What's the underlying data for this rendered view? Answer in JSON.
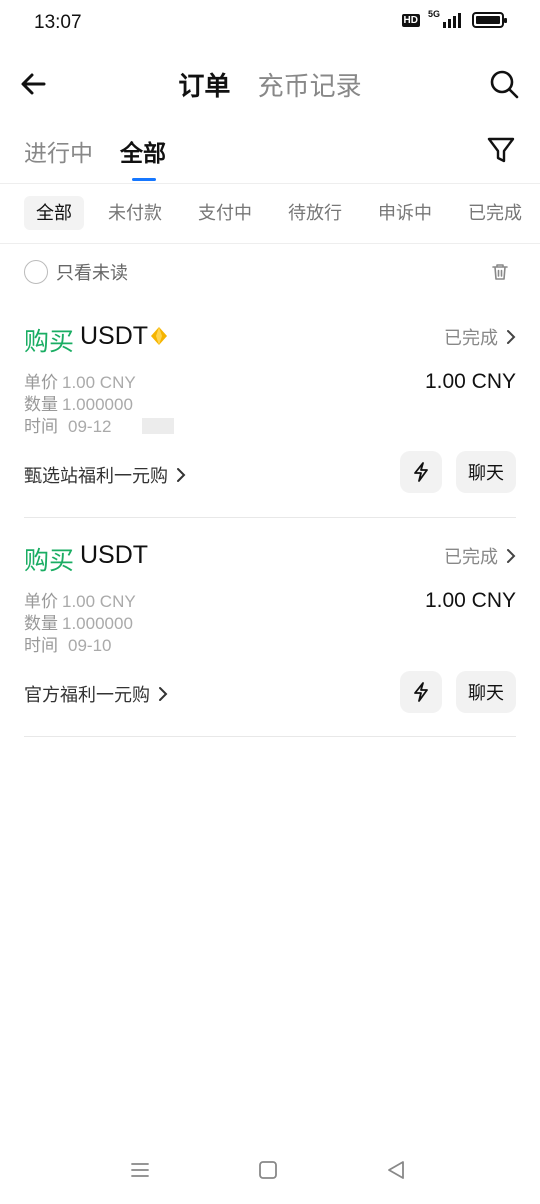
{
  "status_bar": {
    "time": "13:07",
    "hd_label": "HD",
    "network_label": "5G",
    "icons": [
      "hd-icon",
      "signal-icon",
      "battery-icon"
    ]
  },
  "header": {
    "tabs": [
      {
        "label": "订单",
        "active": true
      },
      {
        "label": "充币记录",
        "active": false
      }
    ],
    "icons": [
      "back-arrow-icon",
      "search-icon"
    ]
  },
  "subtabs": [
    {
      "label": "进行中",
      "active": false
    },
    {
      "label": "全部",
      "active": true
    }
  ],
  "chips": [
    {
      "label": "全部",
      "active": true
    },
    {
      "label": "未付款",
      "active": false
    },
    {
      "label": "支付中",
      "active": false
    },
    {
      "label": "待放行",
      "active": false
    },
    {
      "label": "申诉中",
      "active": false
    },
    {
      "label": "已完成",
      "active": false
    }
  ],
  "filters": {
    "unread_only_label": "只看未读"
  },
  "orders": [
    {
      "type": "购买",
      "coin": "USDT",
      "has_badge": true,
      "status": "已完成",
      "price_label": "单价",
      "price_value": "1.00 CNY",
      "qty_label": "数量",
      "qty_value": "1.000000",
      "time_label": "时间",
      "time_value": "09-12",
      "amount": "1.00 CNY",
      "promo": "甄选站福利一元购",
      "chat_label": "聊天"
    },
    {
      "type": "购买",
      "coin": "USDT",
      "has_badge": false,
      "status": "已完成",
      "price_label": "单价",
      "price_value": "1.00 CNY",
      "qty_label": "数量",
      "qty_value": "1.000000",
      "time_label": "时间",
      "time_value": "09-10",
      "amount": "1.00 CNY",
      "promo": "官方福利一元购",
      "chat_label": "聊天"
    }
  ],
  "colors": {
    "buy_green": "#1aad63",
    "accent_blue": "#1677ff"
  }
}
